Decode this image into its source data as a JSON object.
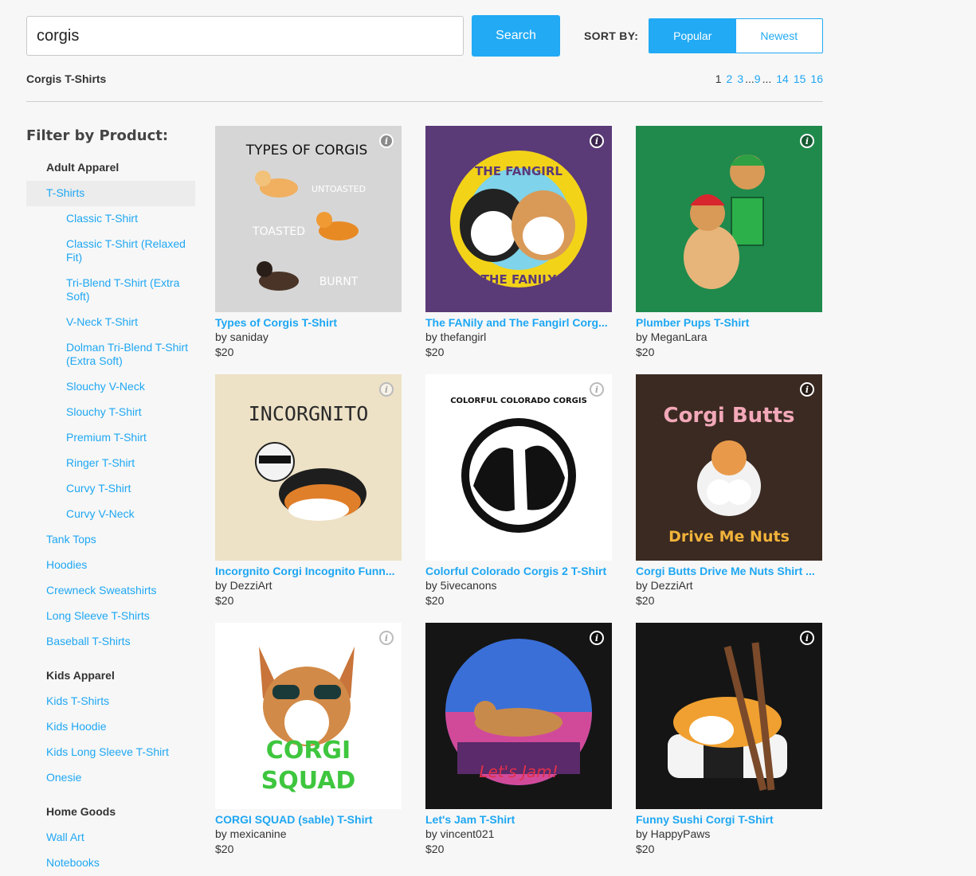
{
  "search": {
    "value": "corgis",
    "button_label": "Search"
  },
  "sort": {
    "label": "SORT BY:",
    "options": [
      "Popular",
      "Newest"
    ],
    "selected": "Popular"
  },
  "results_title": "Corgis T-Shirts",
  "pagination": {
    "current": "1",
    "pages": [
      "2",
      "3"
    ],
    "ellipsis": "...",
    "mid": "9",
    "end_pages": [
      "14",
      "15",
      "16"
    ]
  },
  "filter_heading": "Filter by Product:",
  "sidebar": {
    "adult_apparel": "Adult Apparel",
    "tshirts": "T-Shirts",
    "tshirt_types": [
      "Classic T-Shirt",
      "Classic T-Shirt (Relaxed Fit)",
      "Tri-Blend T-Shirt (Extra Soft)",
      "V-Neck T-Shirt",
      "Dolman Tri-Blend T-Shirt (Extra Soft)",
      "Slouchy V-Neck",
      "Slouchy T-Shirt",
      "Premium T-Shirt",
      "Ringer T-Shirt",
      "Curvy T-Shirt",
      "Curvy V-Neck"
    ],
    "adult_other": [
      "Tank Tops",
      "Hoodies",
      "Crewneck Sweatshirts",
      "Long Sleeve T-Shirts",
      "Baseball T-Shirts"
    ],
    "kids_apparel": "Kids Apparel",
    "kids_items": [
      "Kids T-Shirts",
      "Kids Hoodie",
      "Kids Long Sleeve T-Shirt",
      "Onesie"
    ],
    "home_goods": "Home Goods",
    "home_items": [
      "Wall Art",
      "Notebooks"
    ]
  },
  "products": [
    {
      "title": "Types of Corgis T-Shirt",
      "artist": "by saniday",
      "price": "$20",
      "art_text": [
        "TYPES OF CORGIS",
        "UNTOASTED",
        "TOASTED",
        "BURNT"
      ],
      "bg": "#d9d9d9"
    },
    {
      "title": "The FANily and The Fangirl Corg...",
      "artist": "by thefangirl",
      "price": "$20",
      "art_text": [
        "THE FANGIRL",
        "THE FANILY"
      ],
      "bg": "#5b3a78"
    },
    {
      "title": "Plumber Pups T-Shirt",
      "artist": "by MeganLara",
      "price": "$20",
      "art_text": [],
      "bg": "#1f8a4c"
    },
    {
      "title": "Incorgnito Corgi Incognito Funn...",
      "artist": "by DezziArt",
      "price": "$20",
      "art_text": [
        "INCORGNITO"
      ],
      "bg": "#ede1c6"
    },
    {
      "title": "Colorful Colorado Corgis 2 T-Shirt",
      "artist": "by 5ivecanons",
      "price": "$20",
      "art_text": [
        "COLORFUL COLORADO CORGIS"
      ],
      "bg": "#ffffff"
    },
    {
      "title": "Corgi Butts Drive Me Nuts Shirt ...",
      "artist": "by DezziArt",
      "price": "$20",
      "art_text": [
        "Corgi Butts",
        "Drive Me Nuts"
      ],
      "bg": "#3b2a22"
    },
    {
      "title": "CORGI SQUAD (sable) T-Shirt",
      "artist": "by mexicanine",
      "price": "$20",
      "art_text": [
        "CORGI",
        "SQUAD"
      ],
      "bg": "#ffffff"
    },
    {
      "title": "Let's Jam T-Shirt",
      "artist": "by vincent021",
      "price": "$20",
      "art_text": [
        "Let's Jam!"
      ],
      "bg": "#151515"
    },
    {
      "title": "Funny Sushi Corgi T-Shirt",
      "artist": "by HappyPaws",
      "price": "$20",
      "art_text": [],
      "bg": "#151515"
    }
  ],
  "info_icon": "info-icon"
}
